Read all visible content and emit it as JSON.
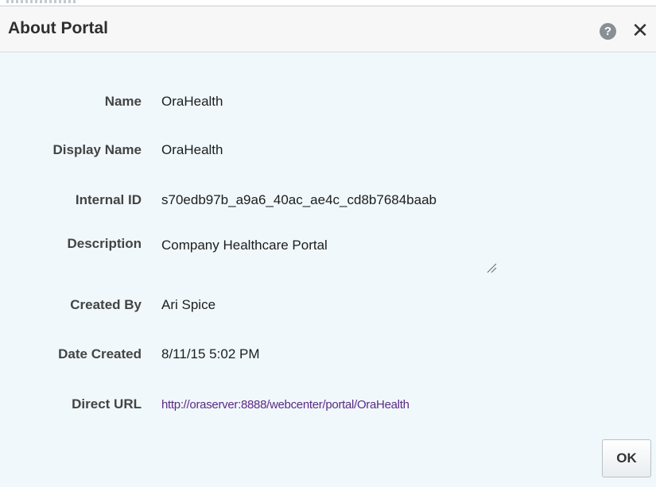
{
  "dialog": {
    "title": "About Portal",
    "help_icon": "question-circle-icon",
    "close_icon": "close-x-icon",
    "help_glyph": "?",
    "close_glyph": "✕",
    "ok_label": "OK"
  },
  "fields": {
    "name": {
      "label": "Name",
      "value": "OraHealth"
    },
    "display_name": {
      "label": "Display Name",
      "value": "OraHealth"
    },
    "internal_id": {
      "label": "Internal ID",
      "value": "s70edb97b_a9a6_40ac_ae4c_cd8b7684baab"
    },
    "description": {
      "label": "Description",
      "value": "Company Healthcare Portal"
    },
    "created_by": {
      "label": "Created By",
      "value": "Ari Spice"
    },
    "date_created": {
      "label": "Date Created",
      "value": "8/11/15 5:02 PM"
    },
    "direct_url": {
      "label": "Direct URL",
      "value": "http://oraserver:8888/webcenter/portal/OraHealth"
    }
  },
  "colors": {
    "dialog_bg": "#f0f8fb",
    "header_bg": "#f7f7f7",
    "link": "#5b2a86"
  }
}
